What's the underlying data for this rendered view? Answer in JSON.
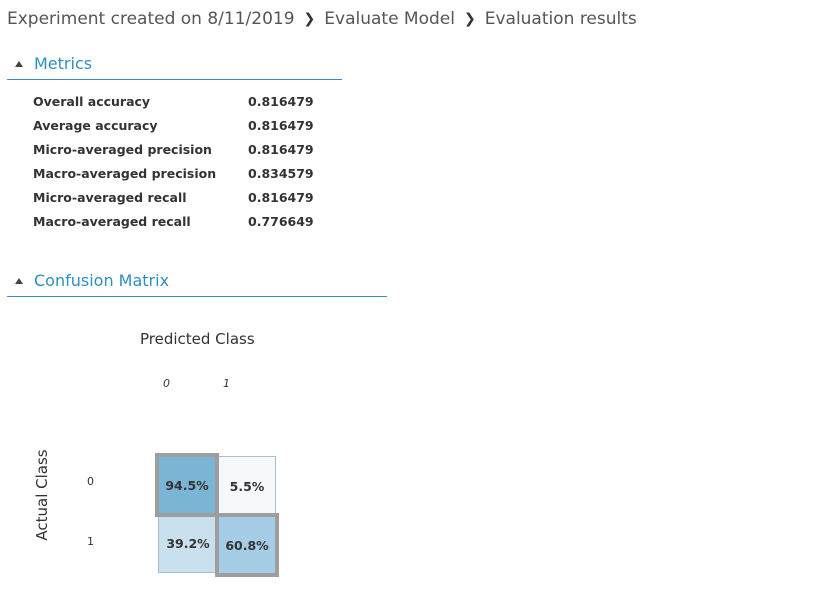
{
  "breadcrumb": {
    "items": [
      "Experiment created on 8/11/2019",
      "Evaluate Model",
      "Evaluation results"
    ],
    "separator": "❯"
  },
  "metrics": {
    "title": "Metrics",
    "rows": [
      {
        "label": "Overall accuracy",
        "value": "0.816479"
      },
      {
        "label": "Average accuracy",
        "value": "0.816479"
      },
      {
        "label": "Micro-averaged precision",
        "value": "0.816479"
      },
      {
        "label": "Macro-averaged precision",
        "value": "0.834579"
      },
      {
        "label": "Micro-averaged recall",
        "value": "0.816479"
      },
      {
        "label": "Macro-averaged recall",
        "value": "0.776649"
      }
    ]
  },
  "confusion": {
    "title": "Confusion Matrix",
    "predicted_label": "Predicted Class",
    "actual_label": "Actual Class",
    "columns": [
      "0",
      "1"
    ],
    "rows": [
      "0",
      "1"
    ],
    "cells": [
      [
        "94.5%",
        "5.5%"
      ],
      [
        "39.2%",
        "60.8%"
      ]
    ],
    "colors": {
      "tp0": "#7ab5d5",
      "fp": "#f6f9fc",
      "fn": "#c9e0ee",
      "tp1": "#a5cde5",
      "accent": "#2e8fc0"
    }
  }
}
